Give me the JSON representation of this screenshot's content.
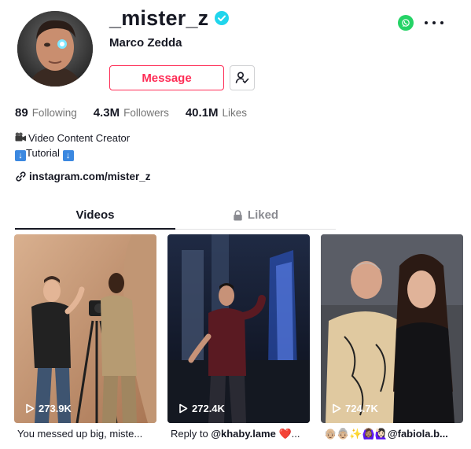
{
  "profile": {
    "username": "_mister_z",
    "display_name": "Marco Zedda",
    "message_label": "Message"
  },
  "stats": [
    {
      "value": "89",
      "label": "Following"
    },
    {
      "value": "4.3M",
      "label": "Followers"
    },
    {
      "value": "40.1M",
      "label": "Likes"
    }
  ],
  "bio": {
    "line1": "Video Content Creator",
    "line2": "Tutorial"
  },
  "link": "instagram.com/mister_z",
  "tabs": [
    {
      "label": "Videos"
    },
    {
      "label": "Liked"
    }
  ],
  "videos": [
    {
      "views": "273.9K",
      "caption": "You messed up big, miste..."
    },
    {
      "views": "272.4K",
      "caption_prefix": "Reply to ",
      "caption_mention": "@khaby.lame",
      "caption_suffix": " ❤️..."
    },
    {
      "views": "724.7K",
      "caption_prefix": "👴🏼👵🏼✨🙆🏽‍♀️🙋🏻‍♀️",
      "caption_mention": "@fabiola.b..."
    }
  ],
  "colors": {
    "accent": "#fe2c55",
    "verified": "#20d5ec",
    "whatsapp": "#25d366"
  },
  "icons": [
    "verified-badge-icon",
    "whatsapp-icon",
    "more-dots-icon",
    "follow-check-icon",
    "camera-emoji-icon",
    "down-arrow-icon",
    "link-icon",
    "lock-icon",
    "play-icon"
  ]
}
